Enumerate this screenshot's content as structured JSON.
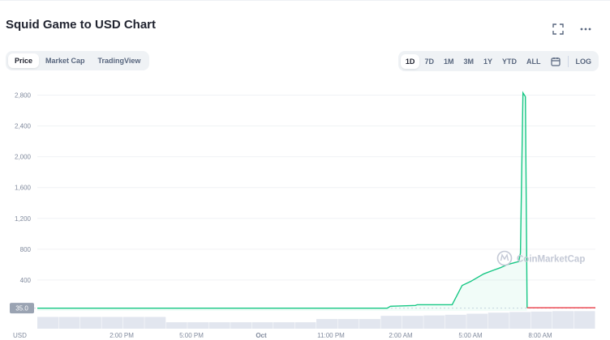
{
  "header": {
    "title": "Squid Game to USD Chart",
    "icons": [
      "fullscreen-icon",
      "more-icon"
    ]
  },
  "view_tabs": [
    {
      "label": "Price",
      "active": true
    },
    {
      "label": "Market Cap",
      "active": false
    },
    {
      "label": "TradingView",
      "active": false
    }
  ],
  "range_tabs": [
    {
      "label": "1D",
      "active": true
    },
    {
      "label": "7D",
      "active": false
    },
    {
      "label": "1M",
      "active": false
    },
    {
      "label": "3M",
      "active": false
    },
    {
      "label": "1Y",
      "active": false
    },
    {
      "label": "YTD",
      "active": false
    },
    {
      "label": "ALL",
      "active": false
    }
  ],
  "log_label": "LOG",
  "watermark": "CoinMarketCap",
  "colors": {
    "line_up": "#16c784",
    "line_down": "#ea3943",
    "accent_bg": "#eff2f5",
    "volume": "#cfd6e4"
  },
  "chart_data": {
    "type": "line",
    "ylabel_currency": "USD",
    "yticks": [
      "2,800",
      "2,400",
      "2,000",
      "1,600",
      "1,200",
      "800",
      "400"
    ],
    "ylim": [
      0,
      2900
    ],
    "current_price_label": "35.0",
    "xticks": [
      "2:00 PM",
      "5:00 PM",
      "Oct",
      "11:00 PM",
      "2:00 AM",
      "5:00 AM",
      "8:00 AM"
    ],
    "x_hours_from_start": [
      0,
      3,
      6,
      9,
      12,
      15,
      18,
      21,
      21.2,
      22.7,
      22.8,
      24.9,
      25.0,
      25.5,
      26.0,
      26.8,
      27.4,
      27.8,
      28.2,
      28.9,
      29.0,
      29.15,
      29.3,
      29.4,
      30,
      31,
      32,
      33,
      33.5
    ],
    "prices": [
      35,
      35,
      35,
      35,
      35,
      35,
      35,
      35,
      60,
      70,
      80,
      80,
      120,
      330,
      380,
      480,
      530,
      560,
      600,
      640,
      750,
      2830,
      2780,
      40,
      40,
      40,
      40,
      40,
      40
    ],
    "down_segment_start_hour": 29.4,
    "volume_bars_relative": [
      0.55,
      0.55,
      0.55,
      0.55,
      0.55,
      0.55,
      0.3,
      0.3,
      0.3,
      0.3,
      0.3,
      0.3,
      0.3,
      0.45,
      0.45,
      0.45,
      0.6,
      0.6,
      0.62,
      0.65,
      0.7,
      0.75,
      0.78,
      0.8,
      0.82,
      0.82
    ]
  }
}
